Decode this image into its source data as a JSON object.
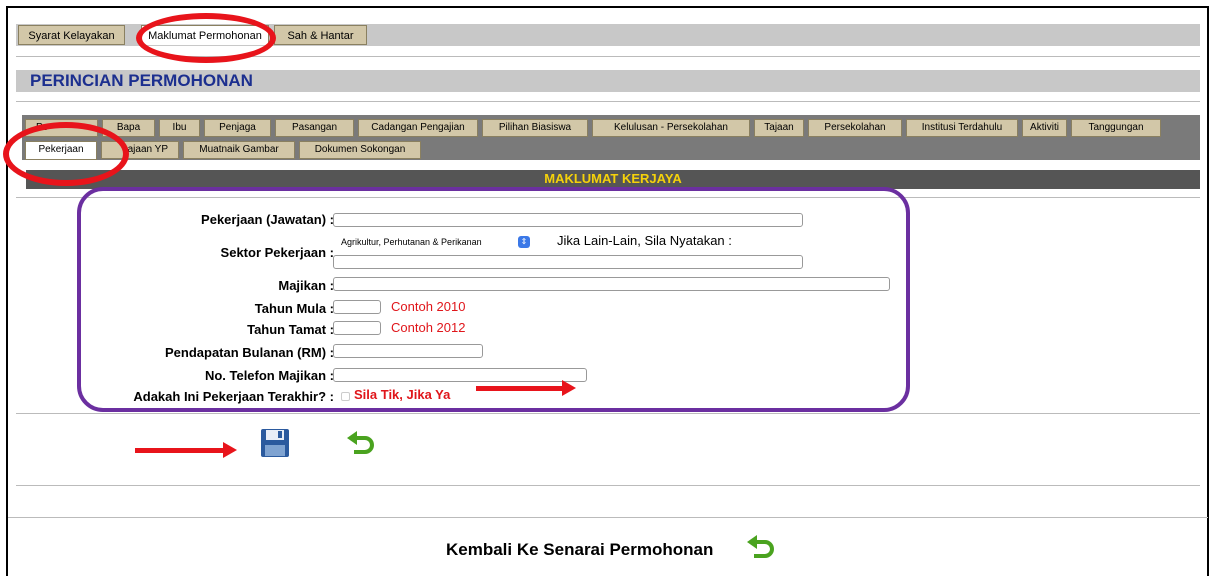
{
  "top_tabs": [
    {
      "label": "Syarat Kelayakan"
    },
    {
      "label": "Maklumat Permohonan",
      "active": true
    },
    {
      "label": "Sah & Hantar"
    }
  ],
  "section_title": "PERINCIAN PERMOHONAN",
  "sub_tabs_row1": [
    "Pe",
    "Bapa",
    "Ibu",
    "Penjaga",
    "Pasangan",
    "Cadangan Pengajian",
    "Pilihan Biasiswa",
    "Kelulusan - Persekolahan",
    "Tajaan",
    "Persekolahan",
    "Institusi Terdahulu",
    "Aktiviti",
    "Tanggungan"
  ],
  "sub_tabs_row2": [
    "Pekerjaan",
    "ajaan YP",
    "Muatnaik Gambar",
    "Dokumen Sokongan"
  ],
  "form_header": "MAKLUMAT KERJAYA",
  "form": {
    "pekerjaan_label": "Pekerjaan (Jawatan)  :",
    "sektor_label": "Sektor Pekerjaan  :",
    "sektor_selected": "Agrikultur, Perhutanan & Perikanan",
    "lain_lain_text": "Jika Lain-Lain, Sila Nyatakan :",
    "majikan_label": "Majikan  :",
    "tahun_mula_label": "Tahun Mula  :",
    "tahun_mula_hint": "Contoh 2010",
    "tahun_tamat_label": "Tahun Tamat  :",
    "tahun_tamat_hint": "Contoh 2012",
    "pendapatan_label": "Pendapatan Bulanan (RM)  :",
    "telefon_label": "No. Telefon Majikan  :",
    "terakhir_label": "Adakah Ini Pekerjaan Terakhir?  :",
    "terakhir_hint": "Sila Tik, Jika Ya"
  },
  "bottom_link": "Kembali Ke Senarai Permohonan",
  "colors": {
    "annotation_red": "#e8141b",
    "annotation_purple": "#6b2fa0",
    "title_blue": "#1c2f8f",
    "header_yellow": "#f5d20a"
  },
  "icons": [
    "save-icon",
    "undo-icon"
  ]
}
